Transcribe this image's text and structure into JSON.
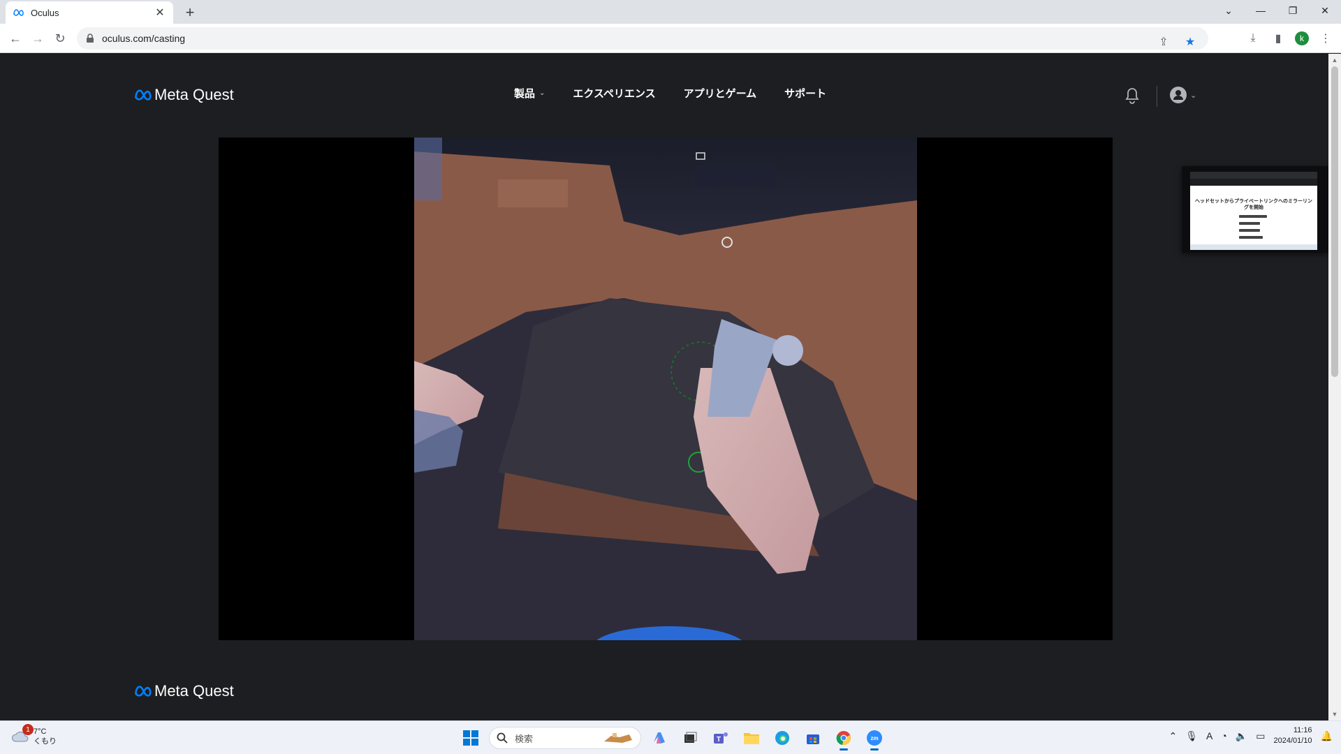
{
  "browser": {
    "tab_title": "Oculus",
    "url": "oculus.com/casting",
    "profile_initial": "k"
  },
  "site": {
    "logo_text": "Meta Quest",
    "nav": [
      {
        "label": "製品",
        "has_dropdown": true
      },
      {
        "label": "エクスペリエンス",
        "has_dropdown": false
      },
      {
        "label": "アプリとゲーム",
        "has_dropdown": false
      },
      {
        "label": "サポート",
        "has_dropdown": false
      }
    ],
    "footer_logo_text": "Meta Quest",
    "thumbnail_title": "ヘッドセットからプライベートリンクへのミラーリングを開始"
  },
  "taskbar": {
    "weather_temp": "7°C",
    "weather_cond": "くもり",
    "weather_badge": "1",
    "search_placeholder": "検索",
    "time": "11:16",
    "date": "2024/01/10",
    "ime_indicator": "A"
  },
  "colors": {
    "page_bg": "#1c1e21",
    "meta_blue": "#0081fb",
    "video_bg": "#000000"
  }
}
